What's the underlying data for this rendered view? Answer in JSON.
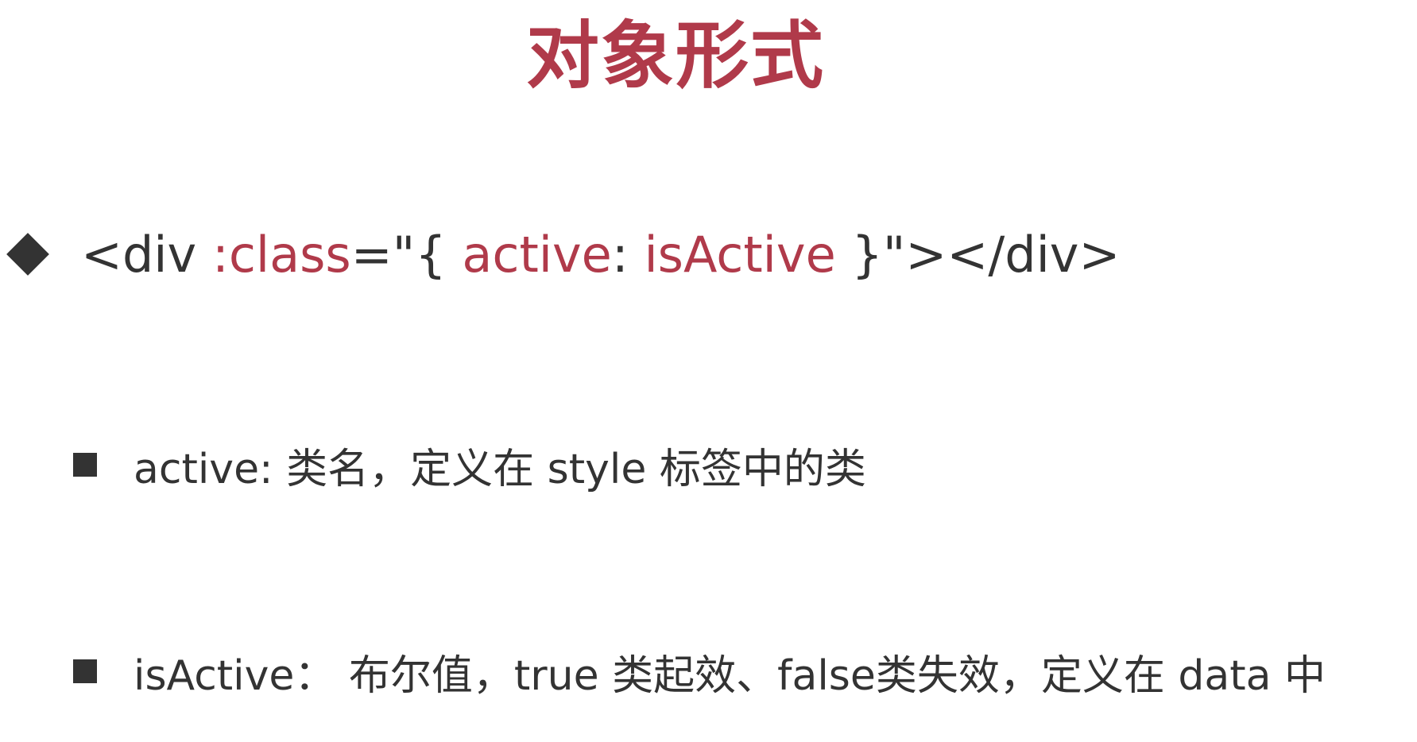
{
  "slide": {
    "title": "对象形式",
    "code": {
      "prefix": "<div ",
      "directive": ":class",
      "mid": "=\"{ ",
      "key": "active",
      "colon": ": ",
      "value": "isActive",
      "suffix": " }\"></div>"
    },
    "points": [
      {
        "text": "active: 类名，定义在 style 标签中的类"
      },
      {
        "text": "isActive： 布尔值，true 类起效、false类失效，定义在 data 中"
      }
    ]
  },
  "colors": {
    "accent": "#b03a4a",
    "text": "#333333",
    "background": "#ffffff"
  }
}
